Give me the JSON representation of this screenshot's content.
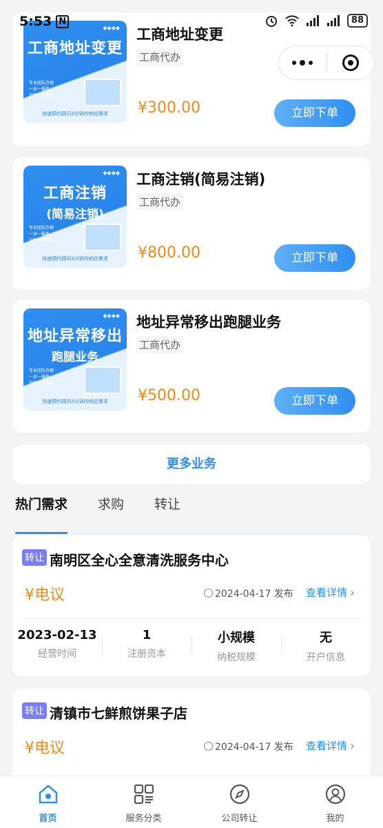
{
  "status": {
    "time": "5:53",
    "nfc": "N",
    "battery": "88"
  },
  "products": [
    {
      "thumb_big": "工商地址变更",
      "thumb_big2": "",
      "thumb_foot": "快速预约顾问3分钟内响应需求",
      "title": "工商地址变更",
      "tag": "工商代办",
      "price": "¥300.00",
      "button": "立即下单"
    },
    {
      "thumb_big": "工商注销",
      "thumb_big2": "(简易注销)",
      "thumb_foot": "快速预约顾问3分钟内响应需求",
      "title": "工商注销(简易注销)",
      "tag": "工商代办",
      "price": "¥800.00",
      "button": "立即下单"
    },
    {
      "thumb_big": "地址异常移出",
      "thumb_big2": "跑腿业务",
      "thumb_foot": "快速预约顾问3分钟内响应需求",
      "title": "地址异常移出跑腿业务",
      "tag": "工商代办",
      "price": "¥500.00",
      "button": "立即下单"
    }
  ],
  "thumb_bullets": [
    "专业团队办理",
    "一对一服务",
    "证件真实可查"
  ],
  "more_label": "更多业务",
  "tabs": [
    "热门需求",
    "求购",
    "转让"
  ],
  "listings": [
    {
      "badge": "转让",
      "name": "南明区全心全意清洗服务中心",
      "price": "¥电议",
      "date": "2024-04-17 发布",
      "detail": "查看详情 ›",
      "stats": [
        {
          "value": "2023-02-13",
          "label": "经营时间"
        },
        {
          "value": "1",
          "label": "注册资本"
        },
        {
          "value": "小规模",
          "label": "纳税规模"
        },
        {
          "value": "无",
          "label": "开户信息"
        }
      ]
    },
    {
      "badge": "转让",
      "name": "清镇市七鲜煎饼果子店",
      "price": "¥电议",
      "date": "2024-04-17 发布",
      "detail": "查看详情 ›"
    }
  ],
  "nav": [
    {
      "label": "首页",
      "icon": "home-icon"
    },
    {
      "label": "服务分类",
      "icon": "category-icon"
    },
    {
      "label": "公司转让",
      "icon": "compass-icon"
    },
    {
      "label": "我的",
      "icon": "user-icon"
    }
  ],
  "colors": {
    "accent": "#2f8ff0",
    "price": "#f28a1a",
    "badge": "#7b7ef2"
  }
}
